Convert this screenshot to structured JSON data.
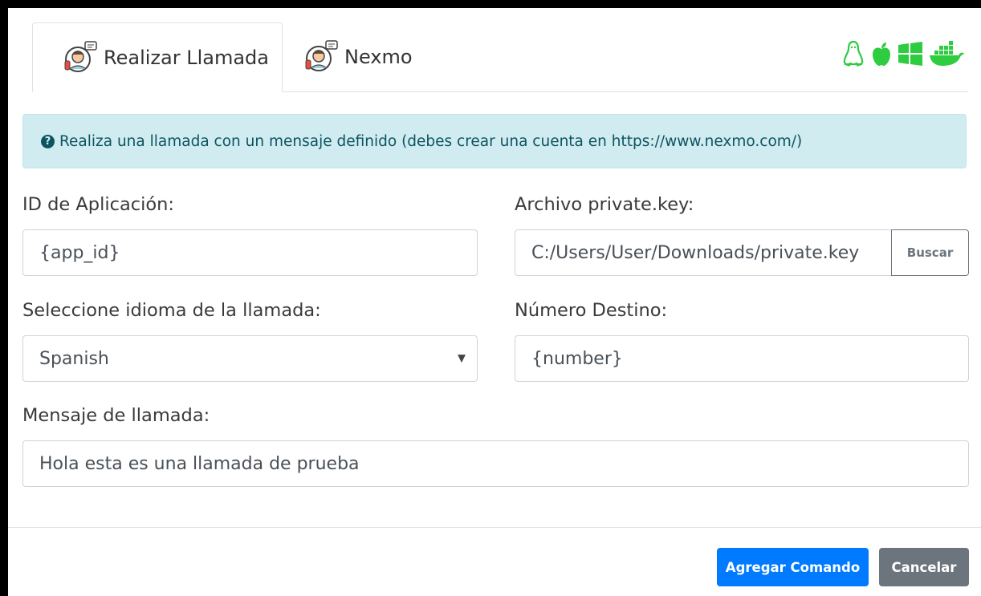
{
  "tabs": [
    {
      "label": "Realizar Llamada",
      "active": true,
      "icon": "call-agent-icon"
    },
    {
      "label": "Nexmo",
      "active": false,
      "icon": "call-agent-icon"
    }
  ],
  "os_icons": [
    "linux-icon",
    "apple-icon",
    "windows-icon",
    "docker-icon"
  ],
  "alert": {
    "icon": "question-circle-icon",
    "text": "Realiza una llamada con un mensaje definido (debes crear una cuenta en https://www.nexmo.com/)"
  },
  "form": {
    "app_id": {
      "label": "ID de Aplicación:",
      "value": "{app_id}"
    },
    "private_key": {
      "label": "Archivo private.key:",
      "value": "C:/Users/User/Downloads/private.key",
      "browse_label": "Buscar"
    },
    "language": {
      "label": "Seleccione idioma de la llamada:",
      "value": "Spanish"
    },
    "destination": {
      "label": "Número Destino:",
      "value": "{number}"
    },
    "message": {
      "label": "Mensaje de llamada:",
      "value": "Hola esta es una llamada de prueba"
    }
  },
  "footer": {
    "add_label": "Agregar Comando",
    "cancel_label": "Cancelar"
  },
  "colors": {
    "primary": "#007bff",
    "secondary": "#6c757d",
    "alert_bg": "#d1ecf1",
    "alert_text": "#0c5460",
    "os_green": "#2ecc40"
  }
}
